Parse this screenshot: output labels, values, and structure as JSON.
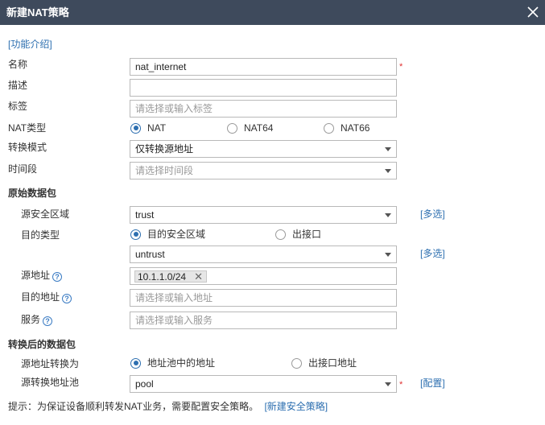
{
  "dialog": {
    "title": "新建NAT策略"
  },
  "intro_link": "[功能介绍]",
  "form": {
    "name": {
      "label": "名称",
      "value": "nat_internet",
      "required_mark": "*"
    },
    "description": {
      "label": "描述",
      "value": ""
    },
    "tag": {
      "label": "标签",
      "placeholder": "请选择或输入标签"
    },
    "nat_type": {
      "label": "NAT类型",
      "options": [
        "NAT",
        "NAT64",
        "NAT66"
      ],
      "selected": "NAT"
    },
    "mode": {
      "label": "转换模式",
      "value": "仅转换源地址"
    },
    "time_range": {
      "label": "时间段",
      "placeholder": "请选择时间段"
    }
  },
  "original_packet": {
    "section_title": "原始数据包",
    "src_zone": {
      "label": "源安全区域",
      "value": "trust",
      "multi_link": "[多选]"
    },
    "dst_type": {
      "label": "目的类型",
      "options": [
        "目的安全区域",
        "出接口"
      ],
      "selected": "目的安全区域"
    },
    "dst_zone": {
      "value": "untrust",
      "multi_link": "[多选]"
    },
    "src_addr": {
      "label": "源地址",
      "tag": "10.1.1.0/24",
      "tag_remove": "✕"
    },
    "dst_addr": {
      "label": "目的地址",
      "placeholder": "请选择或输入地址"
    },
    "service": {
      "label": "服务",
      "placeholder": "请选择或输入服务"
    }
  },
  "translated_packet": {
    "section_title": "转换后的数据包",
    "src_translate_to": {
      "label": "源地址转换为",
      "options": [
        "地址池中的地址",
        "出接口地址"
      ],
      "selected": "地址池中的地址"
    },
    "pool": {
      "label": "源转换地址池",
      "value": "pool",
      "required_mark": "*",
      "config_link": "[配置]"
    }
  },
  "footer": {
    "hint": "提示：为保证设备顺利转发NAT业务，需要配置安全策略。",
    "link": "[新建安全策略]"
  },
  "help_glyph": "?",
  "colors": {
    "titlebar": "#3e4a5c",
    "link": "#2d6fb0",
    "required": "#e03131"
  }
}
